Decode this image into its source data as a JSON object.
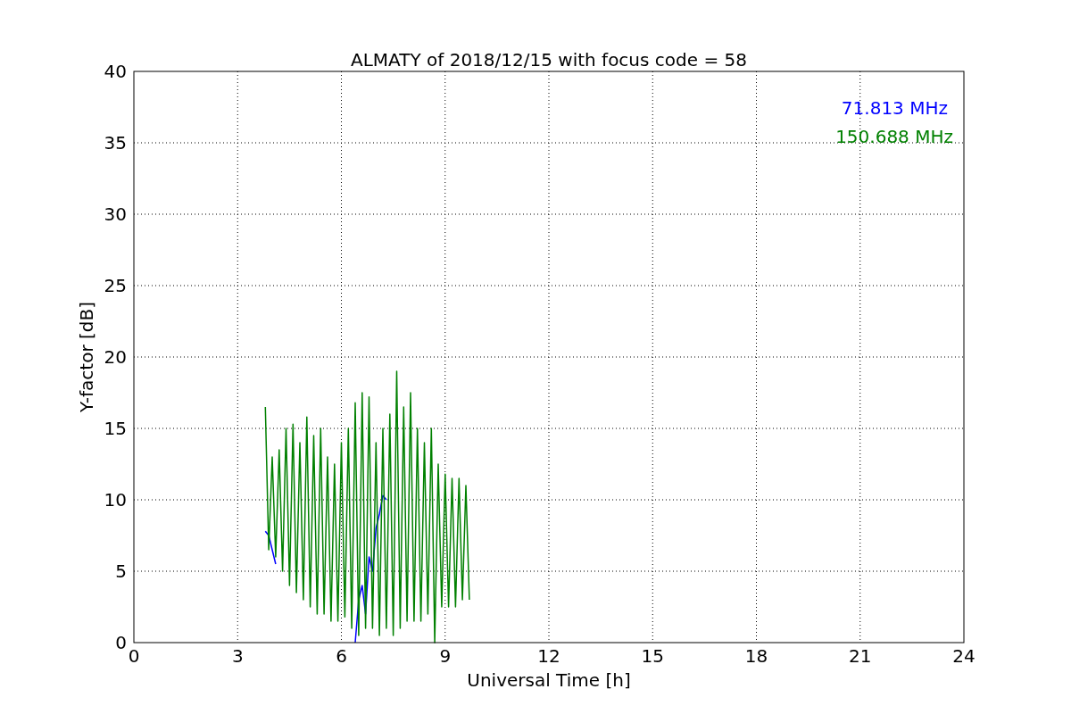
{
  "chart_data": {
    "type": "line",
    "title": "ALMATY of 2018/12/15 with focus code = 58",
    "xlabel": "Universal Time [h]",
    "ylabel": "Y-factor [dB]",
    "xlim": [
      0,
      24
    ],
    "ylim": [
      0,
      40
    ],
    "grid": true,
    "xticks": [
      0,
      3,
      6,
      9,
      12,
      15,
      18,
      21,
      24
    ],
    "yticks": [
      0,
      5,
      10,
      15,
      20,
      25,
      30,
      35,
      40
    ],
    "x": [
      3.8,
      3.9,
      4.0,
      4.1,
      4.2,
      4.3,
      4.4,
      4.5,
      4.6,
      4.7,
      4.8,
      4.9,
      5.0,
      5.1,
      5.2,
      5.3,
      5.4,
      5.5,
      5.6,
      5.7,
      5.8,
      5.9,
      6.0,
      6.1,
      6.2,
      6.3,
      6.4,
      6.5,
      6.6,
      6.7,
      6.8,
      6.9,
      7.0,
      7.1,
      7.2,
      7.3,
      7.4,
      7.5,
      7.6,
      7.7,
      7.8,
      7.9,
      8.0,
      8.1,
      8.2,
      8.3,
      8.4,
      8.5,
      8.6,
      8.7,
      8.8,
      8.9,
      9.0,
      9.1,
      9.2,
      9.3,
      9.4,
      9.5,
      9.6,
      9.7
    ],
    "series": [
      {
        "name": "71.813 MHz",
        "color": "#0000ff",
        "values": [
          7.8,
          7.5,
          6.5,
          5.5,
          null,
          null,
          null,
          null,
          null,
          null,
          null,
          null,
          null,
          null,
          null,
          null,
          null,
          null,
          null,
          null,
          null,
          null,
          null,
          null,
          null,
          null,
          0,
          3,
          4,
          2,
          6,
          5,
          8,
          9,
          10.3,
          10,
          null,
          null,
          null,
          null,
          null,
          null,
          null,
          null,
          null,
          null,
          null,
          null,
          null,
          null,
          null,
          null,
          null,
          null,
          null,
          null,
          null,
          null,
          null,
          null
        ]
      },
      {
        "name": "150.688 MHz",
        "color": "#008000",
        "values": [
          16.5,
          6.5,
          13,
          6,
          13.5,
          5,
          15,
          4,
          15.3,
          3.5,
          14,
          3,
          15.8,
          2.5,
          14.5,
          2,
          15,
          2,
          13,
          1.5,
          12.5,
          1.5,
          14,
          1.8,
          15,
          1,
          16.8,
          0.5,
          17.5,
          1,
          17.2,
          1,
          14,
          0.5,
          15,
          1,
          16,
          0.5,
          19,
          1,
          16.5,
          1.5,
          17.5,
          1.5,
          15,
          1.5,
          14,
          2,
          15,
          0,
          12.5,
          2.5,
          11.8,
          2.5,
          11.5,
          2.5,
          11.5,
          3,
          11,
          3
        ]
      }
    ]
  }
}
